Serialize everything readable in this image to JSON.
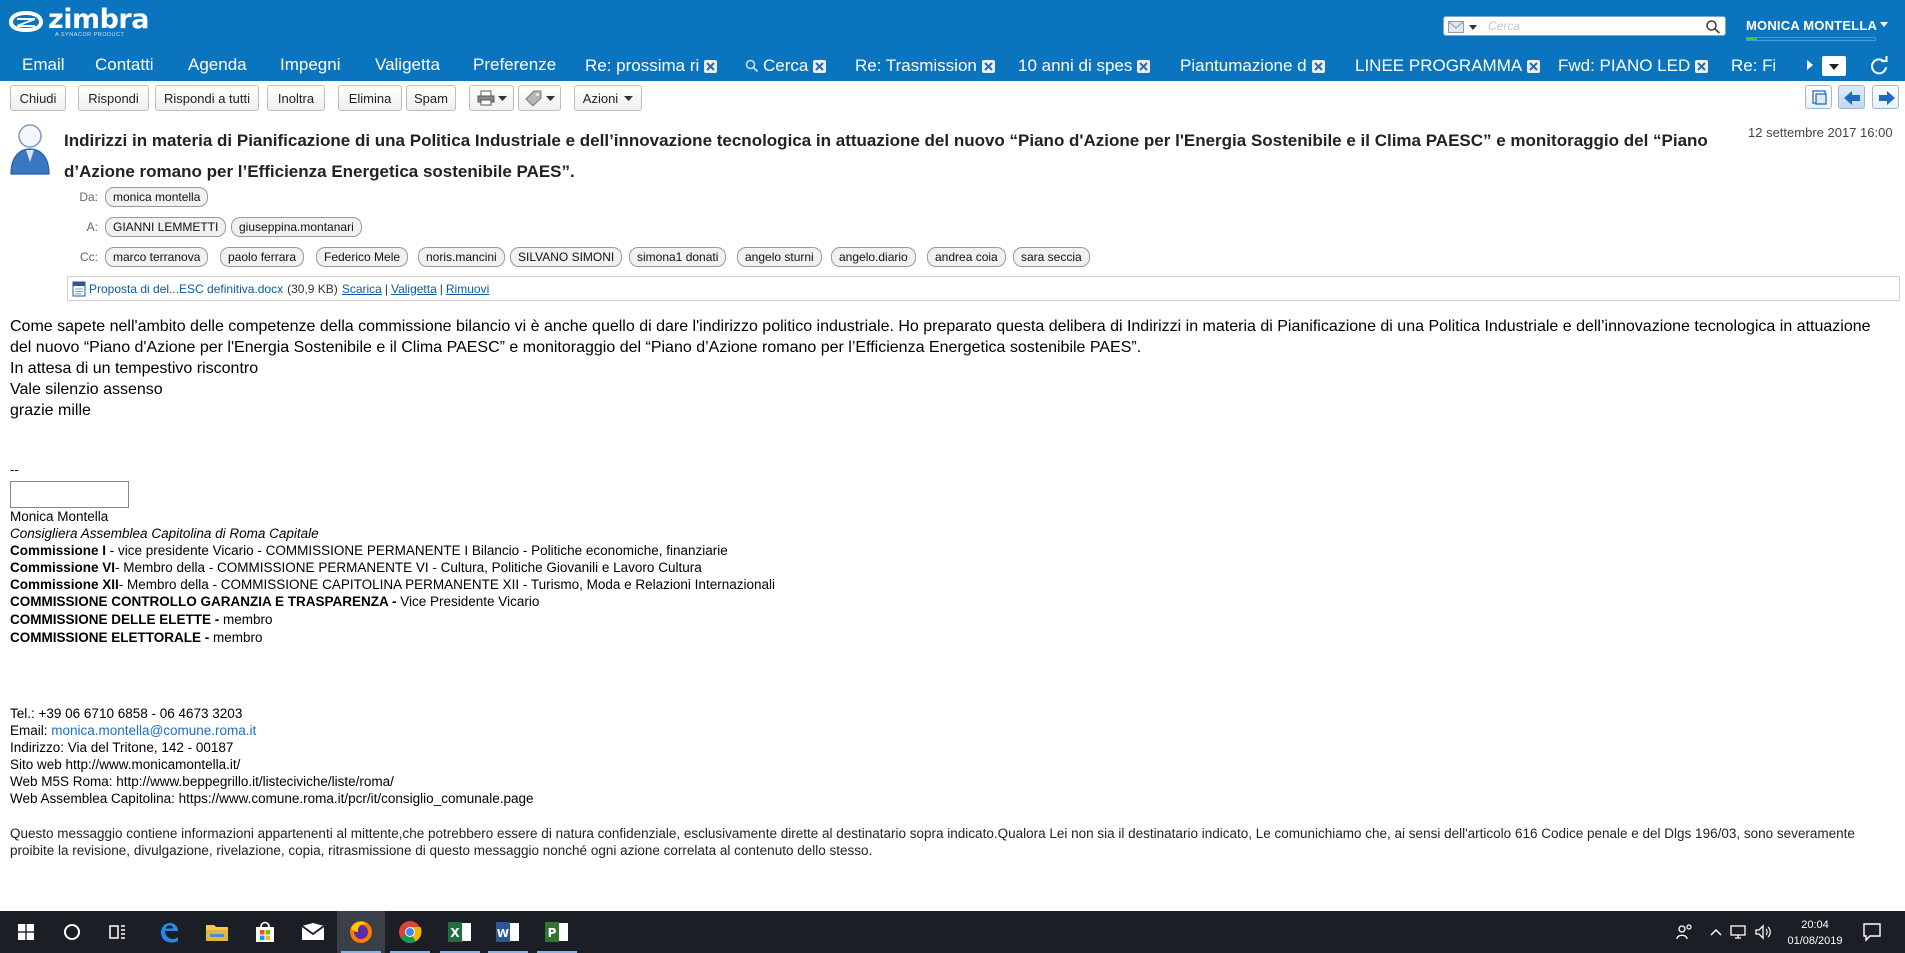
{
  "header": {
    "logo_text": "zimbra",
    "logo_subtitle": "A SYNACOR PRODUCT",
    "search_placeholder": "Cerca",
    "user_name": "MONICA MONTELLA",
    "quota_fraction": 0.08
  },
  "nav": {
    "items": [
      "Email",
      "Contatti",
      "Agenda",
      "Impegni",
      "Valigetta",
      "Preferenze"
    ],
    "tabs": [
      "Re: prossima ri",
      "Cerca",
      "Re: Trasmission",
      "10 anni di spes",
      "Piantumazione d",
      "LINEE PROGRAMMA",
      "Fwd: PIANO LED",
      "Re: Fi"
    ]
  },
  "toolbar": {
    "close": "Chiudi",
    "reply": "Rispondi",
    "reply_all": "Rispondi a tutti",
    "forward": "Inoltra",
    "delete": "Elimina",
    "spam": "Spam",
    "actions": "Azioni"
  },
  "message": {
    "subject": "Indirizzi in materia di Pianificazione di una Politica Industriale e dell’innovazione tecnologica in attuazione del nuovo “Piano d'Azione per l'Energia Sostenibile e il Clima PAESC” e monitoraggio del “Piano d’Azione romano per l’Efficienza Energetica sostenibile PAES”.",
    "date": "12 settembre 2017 16:00",
    "labels": {
      "from": "Da:",
      "to": "A:",
      "cc": "Cc:"
    },
    "from": [
      "monica montella"
    ],
    "to": [
      "GIANNI LEMMETTI",
      "giuseppina.montanari"
    ],
    "cc": [
      "marco terranova",
      "paolo ferrara",
      "Federico Mele",
      "noris.mancini",
      "SILVANO SIMONI",
      "simona1 donati",
      "angelo sturni",
      "angelo.diario",
      "andrea coia",
      "sara seccia"
    ],
    "attachment": {
      "name": "Proposta di del...ESC definitiva.docx",
      "size": "(30,9 KB)",
      "download": "Scarica",
      "briefcase": "Valigetta",
      "remove": "Rimuovi",
      "sep": "|"
    },
    "body": [
      "Come sapete nell'ambito delle competenze della commissione bilancio vi è anche quello di dare l'indirizzo politico industriale. Ho preparato questa delibera di Indirizzi in materia di Pianificazione di una Politica Industriale e dell’innovazione tecnologica in attuazione del nuovo “Piano d'Azione per l'Energia Sostenibile e il Clima PAESC” e monitoraggio del “Piano d’Azione romano per l’Efficienza Energetica sostenibile PAES”.",
      "In attesa di un tempestivo riscontro",
      "Vale silenzio assenso",
      "grazie mille"
    ],
    "sig_dash": "--",
    "signature": {
      "name": "Monica Montella",
      "role": "Consigliera Assemblea Capitolina di Roma Capitale",
      "lines": [
        {
          "bold": "Commissione I",
          "text": " - vice presidente Vicario - COMMISSIONE PERMANENTE I Bilancio - Politiche economiche, finanziarie"
        },
        {
          "bold": "Commissione VI",
          "text": "- Membro della - COMMISSIONE PERMANENTE VI - Cultura, Politiche Giovanili e Lavoro Cultura"
        },
        {
          "bold": "Commissione XII",
          "text": "- Membro della - COMMISSIONE CAPITOLINA PERMANENTE XII - Turismo, Moda e Relazioni Internazionali"
        },
        {
          "bold": "COMMISSIONE CONTROLLO GARANZIA E TRASPARENZA -",
          "text": " Vice Presidente Vicario"
        },
        {
          "bold": "COMMISSIONE DELLE ELETTE -",
          "text": " membro"
        },
        {
          "bold": "COMMISSIONE ELETTORALE -",
          "text": " membro"
        }
      ]
    },
    "contact": {
      "tel": "Tel.: +39 06 6710 6858 - 06 4673 3203",
      "email_label": "Email: ",
      "email": "monica.montella@comune.roma.it",
      "address": "Indirizzo: Via del Tritone, 142 - 00187",
      "site": "Sito web http://www.monicamontella.it/",
      "m5s": "Web M5S Roma: http://www.beppegrillo.it/listeciviche/liste/roma/",
      "assemblea": "Web Assemblea Capitolina: https://www.comune.roma.it/pcr/it/consiglio_comunale.page"
    },
    "disclaimer": " Questo messaggio contiene informazioni appartenenti al mittente,che potrebbero essere di natura confidenziale, esclusivamente dirette al destinatario sopra indicato.Qualora Lei non sia il destinatario indicato, Le comunichiamo che, ai sensi dell'articolo 616 Codice penale e del Dlgs 196/03, sono severamente proibite la revisione, divulgazione, rivelazione, copia, ritrasmissione di questo messaggio nonché ogni azione correlata al contenuto dello stesso."
  },
  "taskbar": {
    "time": "20:04",
    "date": "01/08/2019",
    "excel_letter": "X",
    "word_letter": "W",
    "project_letter": "P"
  },
  "colors": {
    "brand_blue": "#0a74bf",
    "link_blue": "#0a5aa8",
    "taskbar": "#1b1e24"
  }
}
